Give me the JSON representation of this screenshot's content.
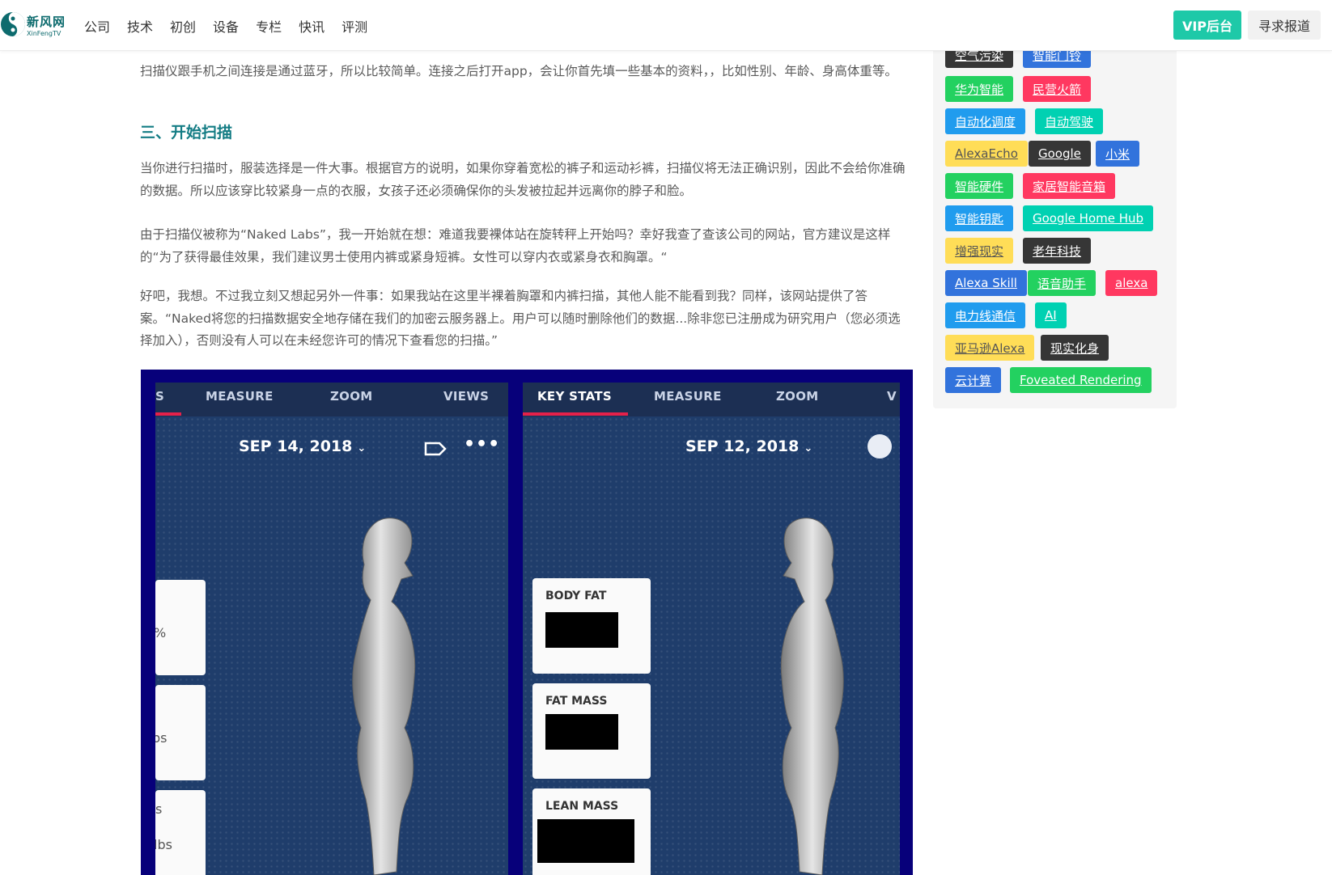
{
  "header": {
    "logo_title": "新风网",
    "logo_sub": "XinFengTV",
    "nav": [
      "公司",
      "技术",
      "初创",
      "设备",
      "专栏",
      "快讯",
      "评测"
    ],
    "vip_button": "VIP后台",
    "report_button": "寻求报道"
  },
  "article": {
    "para1": "扫描仪跟手机之间连接是通过蓝牙，所以比较简单。连接之后打开app，会让你首先填一些基本的资料，，比如性别、年龄、身高体重等。",
    "section_title": "三、开始扫描",
    "para2": "当你进行扫描时，服装选择是一件大事。根据官方的说明，如果你穿着宽松的裤子和运动衫裤，扫描仪将无法正确识别，因此不会给你准确的数据。所以应该穿比较紧身一点的衣服，女孩子还必须确保你的头发被拉起并远离你的脖子和脸。",
    "para3": "由于扫描仪被称为“Naked Labs”，我一开始就在想：难道我要裸体站在旋转秤上开始吗？幸好我查了查该公司的网站，官方建议是这样的“为了获得最佳效果，我们建议男士使用内裤或紧身短裤。女性可以穿内衣或紧身衣和胸罩。“",
    "para4": "好吧，我想。不过我立刻又想起另外一件事：如果我站在这里半裸着胸罩和内裤扫描，其他人能不能看到我？同样，该网站提供了答案。“Naked将您的扫描数据安全地存储在我们的加密云服务器上。用户可以随时删除他们的数据...除非您已注册成为研究用户（您必须选择加入），否则没有人可以在未经您许可的情况下查看您的扫描。”"
  },
  "figure": {
    "left": {
      "tabs": [
        "S",
        "MEASURE",
        "ZOOM",
        "VIEWS"
      ],
      "date": "SEP 14, 2018",
      "chevron": "⌄",
      "more": "•••",
      "card_fragments": [
        "%",
        "bs",
        "s",
        "lbs"
      ]
    },
    "right": {
      "tabs": [
        "KEY STATS",
        "MEASURE",
        "ZOOM",
        "V"
      ],
      "date": "SEP 12, 2018",
      "chevron": "⌄",
      "stats": [
        "BODY FAT",
        "FAT MASS",
        "LEAN MASS"
      ]
    }
  },
  "sidebar": {
    "tags": [
      {
        "label": "空气污染",
        "color": "#363636"
      },
      {
        "label": "智能门铃",
        "color": "#3273dc"
      },
      {
        "label": "华为智能",
        "color": "#23d160"
      },
      {
        "label": "民营火箭",
        "color": "#ff3860"
      },
      {
        "label": "自动化调度",
        "color": "#209cee"
      },
      {
        "label": "自动驾驶",
        "color": "#00d1b2"
      },
      {
        "label": "AlexaEcho",
        "color": "#ffdd57"
      },
      {
        "label": "Google",
        "color": "#363636"
      },
      {
        "label": "小米",
        "color": "#3273dc"
      },
      {
        "label": "智能硬件",
        "color": "#23d160"
      },
      {
        "label": "家居智能音箱",
        "color": "#ff3860"
      },
      {
        "label": "智能钥匙",
        "color": "#209cee"
      },
      {
        "label": "Google Home Hub",
        "color": "#00d1b2"
      },
      {
        "label": "增强现实",
        "color": "#ffdd57"
      },
      {
        "label": "老年科技",
        "color": "#363636"
      },
      {
        "label": "Alexa Skill",
        "color": "#3273dc"
      },
      {
        "label": "语音助手",
        "color": "#23d160"
      },
      {
        "label": "alexa",
        "color": "#ff3860"
      },
      {
        "label": "电力线通信",
        "color": "#209cee"
      },
      {
        "label": "AI",
        "color": "#00d1b2"
      },
      {
        "label": "亚马逊Alexa",
        "color": "#ffdd57"
      },
      {
        "label": "现实化身",
        "color": "#363636"
      },
      {
        "label": "云计算",
        "color": "#3273dc"
      },
      {
        "label": "Foveated Rendering",
        "color": "#23d160"
      }
    ]
  }
}
